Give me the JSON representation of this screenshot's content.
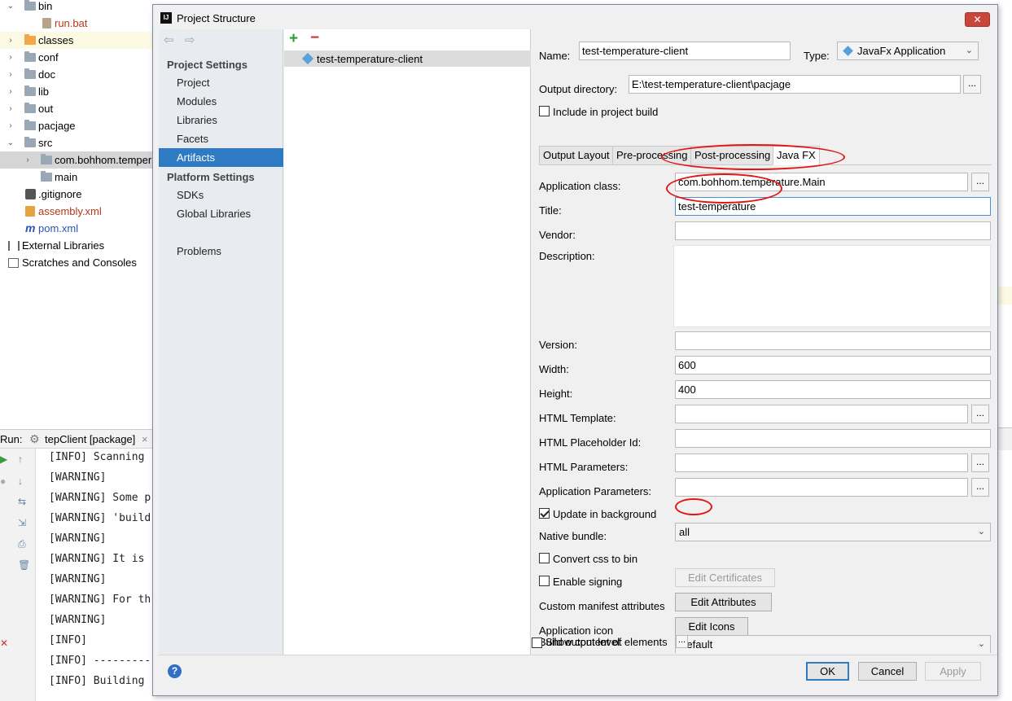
{
  "tree": {
    "items": [
      {
        "label": "bin"
      },
      {
        "label": "run.bat"
      },
      {
        "label": "classes"
      },
      {
        "label": "conf"
      },
      {
        "label": "doc"
      },
      {
        "label": "lib"
      },
      {
        "label": "out"
      },
      {
        "label": "pacjage"
      },
      {
        "label": "src"
      },
      {
        "label": "com.bohhom.temper"
      },
      {
        "label": "main"
      },
      {
        "label": ".gitignore"
      },
      {
        "label": "assembly.xml"
      },
      {
        "label": "pom.xml"
      },
      {
        "label": "External Libraries"
      },
      {
        "label": "Scratches and Consoles"
      }
    ]
  },
  "run": {
    "label": "Run:",
    "tab_label": "tepClient [package]",
    "tab_close": "×",
    "lines": [
      "[INFO] Scanning",
      "[WARNING]",
      "[WARNING] Some p",
      "[WARNING] 'build",
      "[WARNING]",
      "[WARNING] It is",
      "[WARNING]",
      "[WARNING] For th",
      "[WARNING]",
      "[INFO]",
      "[INFO] ---------",
      "[INFO] Building"
    ]
  },
  "dialog": {
    "title": "Project Structure",
    "close": "✕",
    "sidebar": {
      "project_settings_header": "Project Settings",
      "platform_settings_header": "Platform Settings",
      "items": {
        "project": "Project",
        "modules": "Modules",
        "libraries": "Libraries",
        "facets": "Facets",
        "artifacts": "Artifacts",
        "sdks": "SDKs",
        "global_libraries": "Global Libraries",
        "problems": "Problems"
      }
    },
    "artifact_list": {
      "add": "+",
      "remove": "−",
      "items": [
        "test-temperature-client"
      ]
    },
    "artifact": {
      "name_label": "Name:",
      "name_value": "test-temperature-client",
      "type_label": "Type:",
      "type_value": "JavaFx Application",
      "output_dir_label": "Output directory:",
      "output_dir_value": "E:\\test-temperature-client\\pacjage",
      "include_in_build_label": "Include in project build",
      "include_in_build_checked": false,
      "tabs": [
        "Output Layout",
        "Pre-processing",
        "Post-processing",
        "Java FX"
      ],
      "active_tab": "Java FX",
      "javafx": {
        "application_class_label": "Application class:",
        "application_class_value": "com.bohhom.temperature.Main",
        "title_label": "Title:",
        "title_value": "test-temperature",
        "vendor_label": "Vendor:",
        "vendor_value": "",
        "description_label": "Description:",
        "description_value": "",
        "version_label": "Version:",
        "version_value": "",
        "width_label": "Width:",
        "width_value": "600",
        "height_label": "Height:",
        "height_value": "400",
        "html_template_label": "HTML Template:",
        "html_template_value": "",
        "html_placeholder_label": "HTML Placeholder Id:",
        "html_placeholder_value": "",
        "html_parameters_label": "HTML Parameters:",
        "html_parameters_value": "",
        "app_parameters_label": "Application Parameters:",
        "app_parameters_value": "",
        "update_bg_label": "Update in background",
        "update_bg_checked": true,
        "native_bundle_label": "Native bundle:",
        "native_bundle_value": "all",
        "convert_css_label": "Convert css to bin",
        "convert_css_checked": false,
        "enable_signing_label": "Enable signing",
        "enable_signing_checked": false,
        "edit_certificates": "Edit Certificates",
        "custom_manifest_label": "Custom manifest attributes",
        "edit_attributes": "Edit  Attributes",
        "app_icon_label": "Application icon",
        "edit_icons": "Edit Icons",
        "build_output_label": "Build output level:",
        "build_output_value": "Default"
      },
      "show_content_label": "Show content of elements",
      "show_content_checked": false
    },
    "buttons": {
      "ok": "OK",
      "cancel": "Cancel",
      "apply": "Apply",
      "help": "?"
    },
    "ellipsis": "..."
  },
  "colors": {
    "selection": "#2f7bc3",
    "annotation": "#e31414"
  }
}
